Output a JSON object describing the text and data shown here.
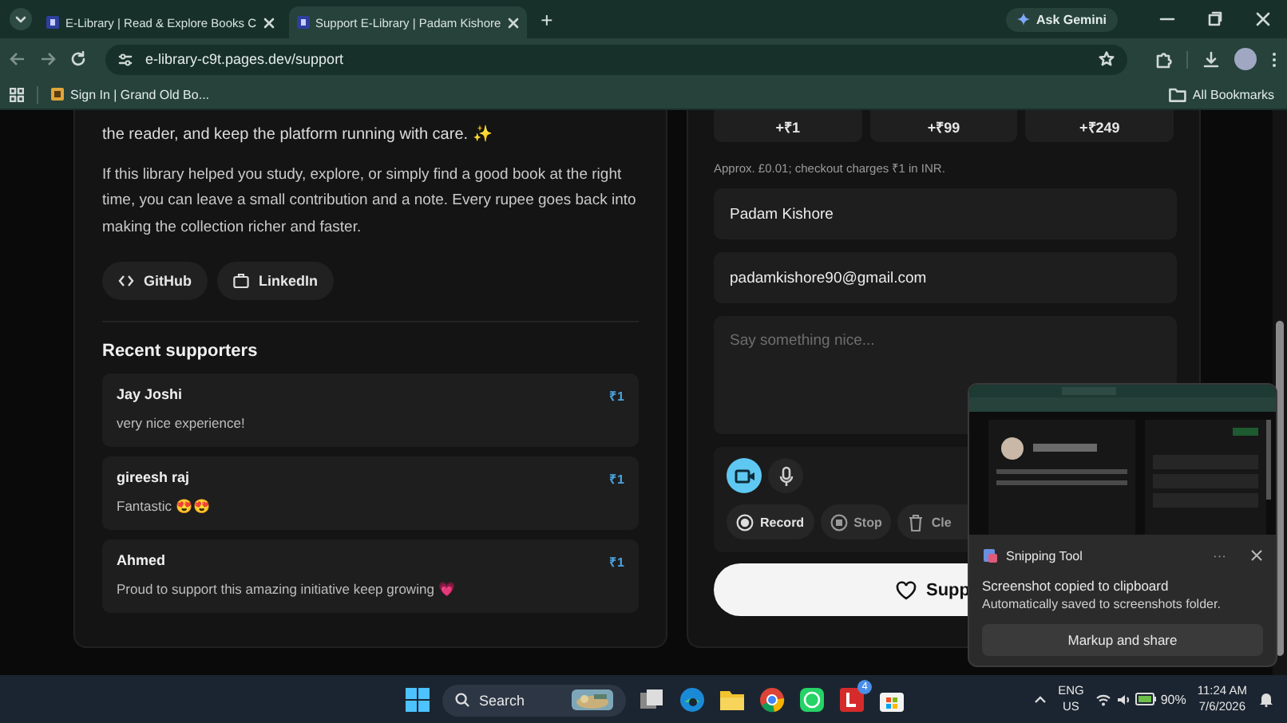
{
  "browser": {
    "tabs": [
      {
        "title": "E-Library | Read & Explore Books C",
        "selected": false
      },
      {
        "title": "Support E-Library | Padam Kishore",
        "selected": true
      }
    ],
    "new_tab": "+",
    "ask_gemini": "Ask Gemini",
    "url": "e-library-c9t.pages.dev/support",
    "bookmarks": [
      {
        "title": "Sign In | Grand Old Bo..."
      }
    ],
    "all_bookmarks": "All Bookmarks"
  },
  "about": {
    "intro": "the reader, and keep the platform running with care. ✨",
    "paragraph": "If this library helped you study, explore, or simply find a good book at the right time, you can leave a small contribution and a note. Every rupee goes back into making the collection richer and faster.",
    "links": [
      {
        "kind": "code",
        "label": "GitHub"
      },
      {
        "kind": "briefcase",
        "label": "LinkedIn"
      }
    ],
    "supporters_title": "Recent supporters",
    "supporters": [
      {
        "name": "Jay Joshi",
        "amount": "₹1",
        "message": "very nice experience!"
      },
      {
        "name": "gireesh raj",
        "amount": "₹1",
        "message": "Fantastic 😍😍"
      },
      {
        "name": "Ahmed",
        "amount": "₹1",
        "message": "Proud to support this amazing initiative keep growing 💗"
      }
    ]
  },
  "support": {
    "amounts": [
      "+₹1",
      "+₹99",
      "+₹249"
    ],
    "note": "Approx. £0.01; checkout charges ₹1 in INR.",
    "name_field": {
      "value": "Padam Kishore"
    },
    "email_field": {
      "value": "padamkishore90@gmail.com"
    },
    "message_field": {
      "placeholder": "Say something nice..."
    },
    "media": [
      {
        "kind": "video",
        "selected": true
      },
      {
        "kind": "mic",
        "selected": false
      }
    ],
    "recorder_buttons": [
      {
        "kind": "record",
        "label": "Record"
      },
      {
        "kind": "stop",
        "label": "Stop"
      },
      {
        "kind": "clear",
        "label": "Cle"
      }
    ],
    "submit": "Supp"
  },
  "toast": {
    "app": "Snipping Tool",
    "more": "···",
    "title": "Screenshot copied to clipboard",
    "body": "Automatically saved to screenshots folder.",
    "button": "Markup and share"
  },
  "taskbar": {
    "search": "Search",
    "badge": "4",
    "language": "ENG",
    "region": "US",
    "battery": "90%",
    "time": "11:24 AM",
    "date": "7/6/2026"
  }
}
